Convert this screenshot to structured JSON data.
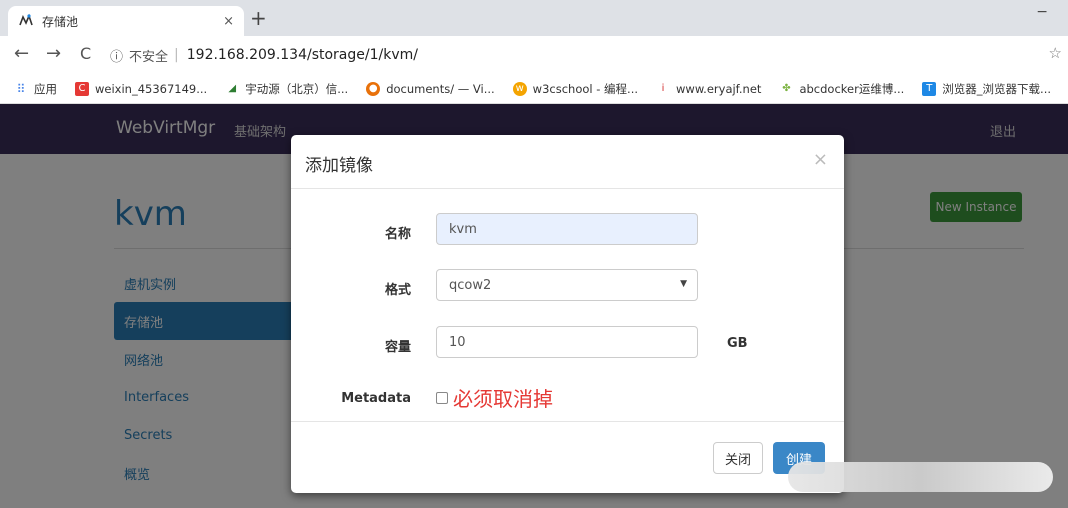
{
  "browser": {
    "tab_title": "存储池",
    "tab_close": "×",
    "new_tab": "+",
    "minimize": "−",
    "nav": {
      "back": "←",
      "forward": "→",
      "reload": "C"
    },
    "url_info": "ⓘ",
    "url_insecure": "不安全",
    "url_separator": "|",
    "url": "192.168.209.134/storage/1/kvm/",
    "bookmarks": [
      {
        "label": "应用",
        "icon": "apps-icon",
        "color": "#4a86e8"
      },
      {
        "label": "weixin_45367149...",
        "icon": "csdn-icon",
        "color": "#e53935"
      },
      {
        "label": "宇动源（北京）信...",
        "icon": "leaf-icon",
        "color": "#2e7d32"
      },
      {
        "label": "documents/ — Vi...",
        "icon": "chrome-icon",
        "color": "#e8710a"
      },
      {
        "label": "w3cschool - 编程...",
        "icon": "w3c-icon",
        "color": "#f4a400"
      },
      {
        "label": "www.eryajf.net",
        "icon": "candle-icon",
        "color": "#d32f2f"
      },
      {
        "label": "abcdocker运维博...",
        "icon": "plant-icon",
        "color": "#7cb342"
      },
      {
        "label": "浏览器_浏览器下载...",
        "icon": "browser-icon",
        "color": "#1e88e5"
      }
    ]
  },
  "app": {
    "brand": "WebVirtMgr",
    "nav_infra": "基础架构",
    "nav_logout": "退出",
    "page_title": "kvm",
    "new_instance": "New Instance",
    "side_menu": [
      {
        "label": "虚机实例"
      },
      {
        "label": "存储池"
      },
      {
        "label": "网络池"
      },
      {
        "label": "Interfaces"
      },
      {
        "label": "Secrets"
      },
      {
        "label": "概览"
      }
    ]
  },
  "modal": {
    "title": "添加镜像",
    "close_x": "×",
    "name_label": "名称",
    "name_value": "kvm",
    "format_label": "格式",
    "format_value": "qcow2",
    "capacity_label": "容量",
    "capacity_value": "10",
    "capacity_unit": "GB",
    "metadata_label": "Metadata",
    "metadata_note": "必须取消掉",
    "btn_close": "关闭",
    "btn_create": "创建"
  }
}
